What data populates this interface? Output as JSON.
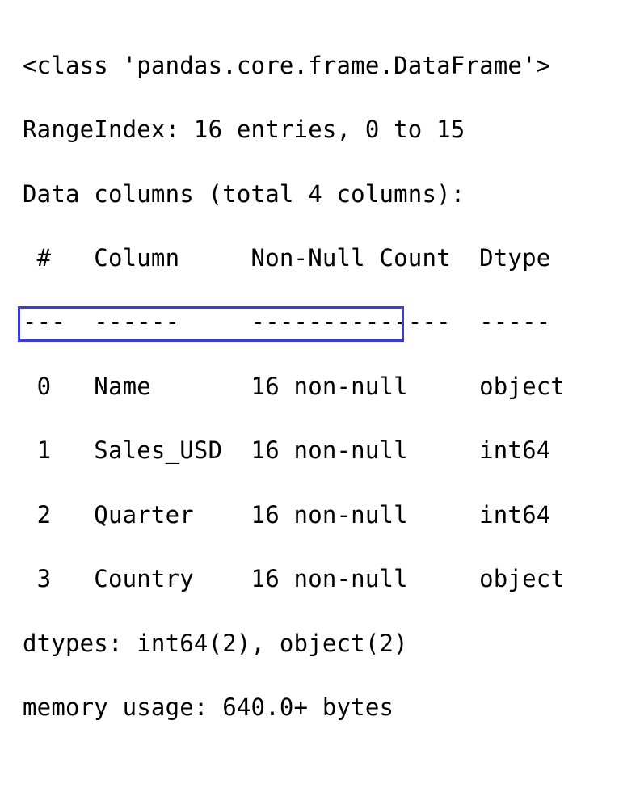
{
  "line1": "<class 'pandas.core.frame.DataFrame'>",
  "line2": "RangeIndex: 16 entries, 0 to 15",
  "line3": "Data columns (total 4 columns):",
  "header": " #   Column     Non-Null Count  Dtype ",
  "divider": "---  ------     --------------  ----- ",
  "rows": [
    " 0   Name       16 non-null     object",
    " 1   Sales_USD  16 non-null     int64 ",
    " 2   Quarter    16 non-null     int64 ",
    " 3   Country    16 non-null     object"
  ],
  "dtypes_line": "dtypes: int64(2), object(2)",
  "memory_line": "memory usage: 640.0+ bytes",
  "highlight_color": "#3b3bd6"
}
